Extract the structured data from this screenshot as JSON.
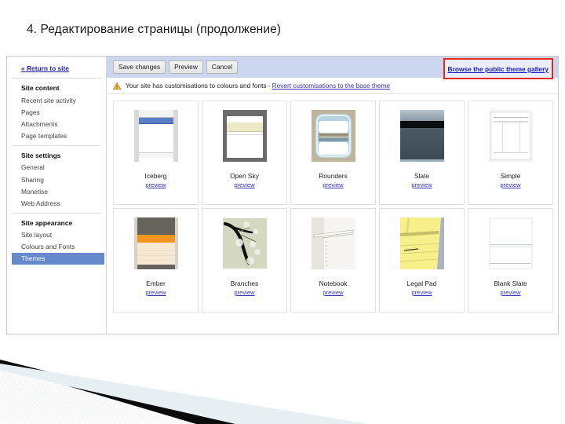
{
  "slide": {
    "title": "4. Редактирование страницы (продолжение)"
  },
  "sidebar": {
    "return_link": "« Return to site",
    "groups": [
      {
        "heading": "Site content",
        "items": [
          "Recent site activity",
          "Pages",
          "Attachments",
          "Page templates"
        ]
      },
      {
        "heading": "Site settings",
        "items": [
          "General",
          "Sharing",
          "Monetise",
          "Web Address"
        ]
      },
      {
        "heading": "Site appearance",
        "items": [
          "Site layout",
          "Colours and Fonts",
          "Themes"
        ]
      }
    ],
    "active_item": "Themes"
  },
  "toolbar": {
    "save_label": "Save changes",
    "preview_label": "Preview",
    "cancel_label": "Cancel",
    "gallery_link": "Browse the public theme gallery",
    "gallery_highlight_color": "#e8271c",
    "background_color": "#ccd6ef"
  },
  "notice": {
    "icon": "warning-triangle-icon",
    "text": "Your site has customisations to colours and fonts -",
    "link": "Revert customisations to the base theme"
  },
  "themes": {
    "preview_label": "preview",
    "items": [
      {
        "name": "Iceberg",
        "thumb": "iceberg"
      },
      {
        "name": "Open Sky",
        "thumb": "opensky"
      },
      {
        "name": "Rounders",
        "thumb": "rounders"
      },
      {
        "name": "Slate",
        "thumb": "slate"
      },
      {
        "name": "Simple",
        "thumb": "simple"
      },
      {
        "name": "Ember",
        "thumb": "ember"
      },
      {
        "name": "Branches",
        "thumb": "branches"
      },
      {
        "name": "Notebook",
        "thumb": "notebook"
      },
      {
        "name": "Legal Pad",
        "thumb": "legalpad"
      },
      {
        "name": "Blank Slate",
        "thumb": "blankslate"
      }
    ]
  }
}
